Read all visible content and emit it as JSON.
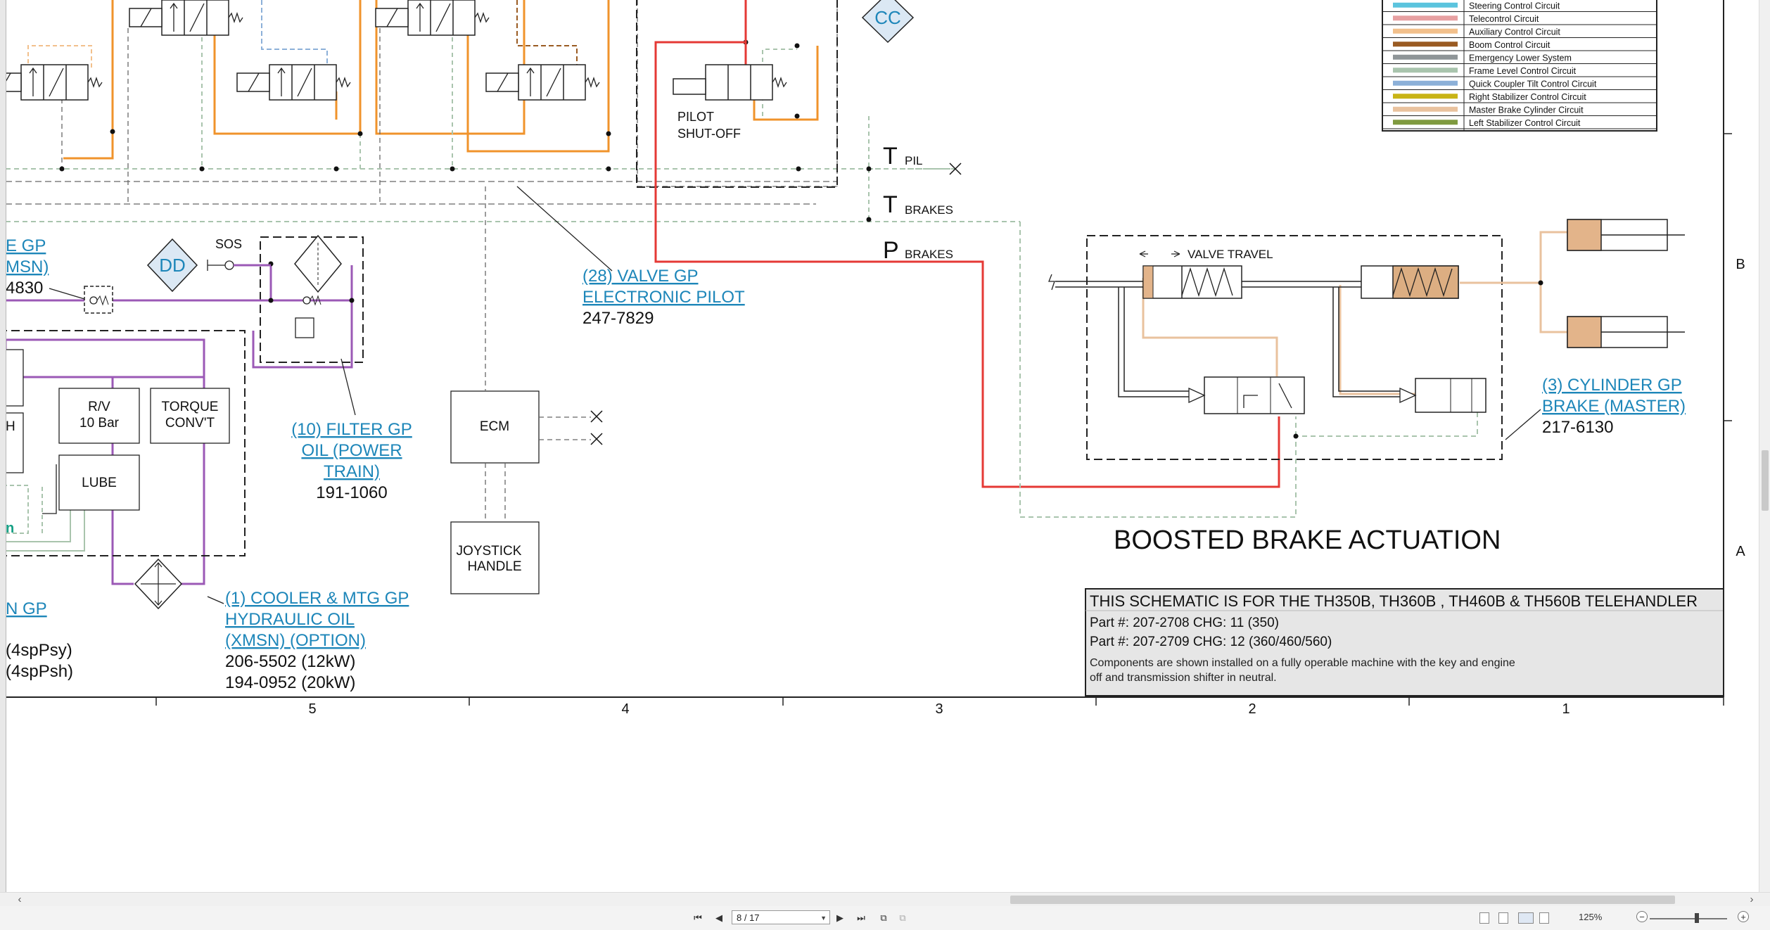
{
  "legend": {
    "items": [
      {
        "label": "Steering Control Circuit",
        "color": "#5bc4de"
      },
      {
        "label": "Telecontrol Circuit",
        "color": "#e7a0a2"
      },
      {
        "label": "Auxiliary Control Circuit",
        "color": "#f2c08c"
      },
      {
        "label": "Boom Control Circuit",
        "color": "#9a5b22"
      },
      {
        "label": "Emergency Lower System",
        "color": "#8f9598"
      },
      {
        "label": "Frame Level Control Circuit",
        "color": "#a9c4ad"
      },
      {
        "label": "Quick Coupler Tilt Control Circuit",
        "color": "#8cb0d8"
      },
      {
        "label": "Right Stabilizer Control Circuit",
        "color": "#c8b416"
      },
      {
        "label": "Master Brake Cylinder Circuit",
        "color": "#e9c29e"
      },
      {
        "label": "Left Stabilizer Control Circuit",
        "color": "#7f9a3f"
      }
    ]
  },
  "markers": {
    "cc": "CC",
    "dd": "DD"
  },
  "labels": {
    "pilot_shutoff_1": "PILOT",
    "pilot_shutoff_2": "SHUT-OFF",
    "sos": "SOS",
    "t_letter": "T",
    "t_pil_sub": "PIL",
    "t_brakes_letter": "T",
    "t_brakes_sub": "BRAKES",
    "p_brakes_letter": "P",
    "p_brakes_sub": "BRAKES",
    "valve_travel": "VALVE TRAVEL",
    "boosted_brake": "BOOSTED BRAKE ACTUATION",
    "rv_1": "R/V",
    "rv_2": "10 Bar",
    "torque_1": "TORQUE",
    "torque_2": "CONV'T",
    "lube": "LUBE",
    "ecm": "ECM",
    "joystick_1": "JOYSTICK",
    "joystick_2": "HANDLE",
    "left_h": "H",
    "left_n": "n"
  },
  "components": {
    "valve_gp": {
      "line1": "(28) VALVE GP",
      "line2": "ELECTRONIC PILOT",
      "part": "247-7829"
    },
    "filter_gp": {
      "line1": "(10) FILTER GP",
      "line2": "OIL (POWER",
      "line3": "TRAIN)",
      "part": "191-1060"
    },
    "cooler_gp": {
      "line1": "(1) COOLER & MTG GP",
      "line2": "HYDRAULIC OIL",
      "line3": "(XMSN) (OPTION)",
      "part1": "206-5502 (12kW)",
      "part2": "194-0952 (20kW)"
    },
    "cylinder_gp": {
      "line1": "(3) CYLINDER GP",
      "line2": "BRAKE (MASTER)",
      "part": "217-6130"
    },
    "left_partial": {
      "line1": "E GP",
      "line2": "MSN)",
      "part": "4830",
      "line3": "N GP",
      "spec1": "(4spPsy)",
      "spec2": "(4spPsh)"
    }
  },
  "titleblock": {
    "line1": "THIS SCHEMATIC IS FOR THE TH350B, TH360B , TH460B & TH560B TELEHANDLER",
    "line2": "Part #: 207-2708 CHG: 11 (350)",
    "line3": "Part #: 207-2709 CHG: 12 (360/460/560)",
    "note1": "Components are shown installed on a fully operable machine with the key and engine",
    "note2": "off and transmission shifter in neutral."
  },
  "grid": {
    "columns": [
      "5",
      "4",
      "3",
      "2",
      "1"
    ],
    "rows": [
      "B",
      "A"
    ]
  },
  "toolbar": {
    "page_value": "8 / 17",
    "zoom": "125%"
  }
}
